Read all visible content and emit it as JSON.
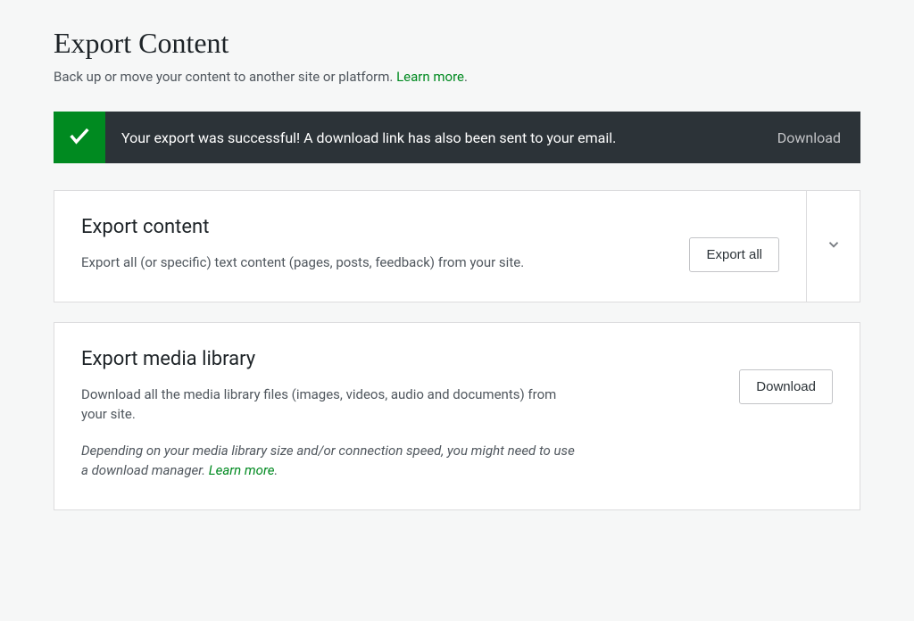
{
  "header": {
    "title": "Export Content",
    "subtitle_prefix": "Back up or move your content to another site or platform. ",
    "subtitle_link": "Learn more",
    "subtitle_suffix": "."
  },
  "banner": {
    "message": "Your export was successful! A download link has also been sent to your email.",
    "download_label": "Download"
  },
  "export_content": {
    "title": "Export content",
    "description": "Export all (or specific) text content (pages, posts, feedback) from your site.",
    "button_label": "Export all"
  },
  "export_media": {
    "title": "Export media library",
    "description": "Download all the media library files (images, videos, audio and documents) from your site.",
    "note_prefix": "Depending on your media library size and/or connection speed, you might need to use a download manager. ",
    "note_link": "Learn more",
    "note_suffix": ".",
    "button_label": "Download"
  }
}
